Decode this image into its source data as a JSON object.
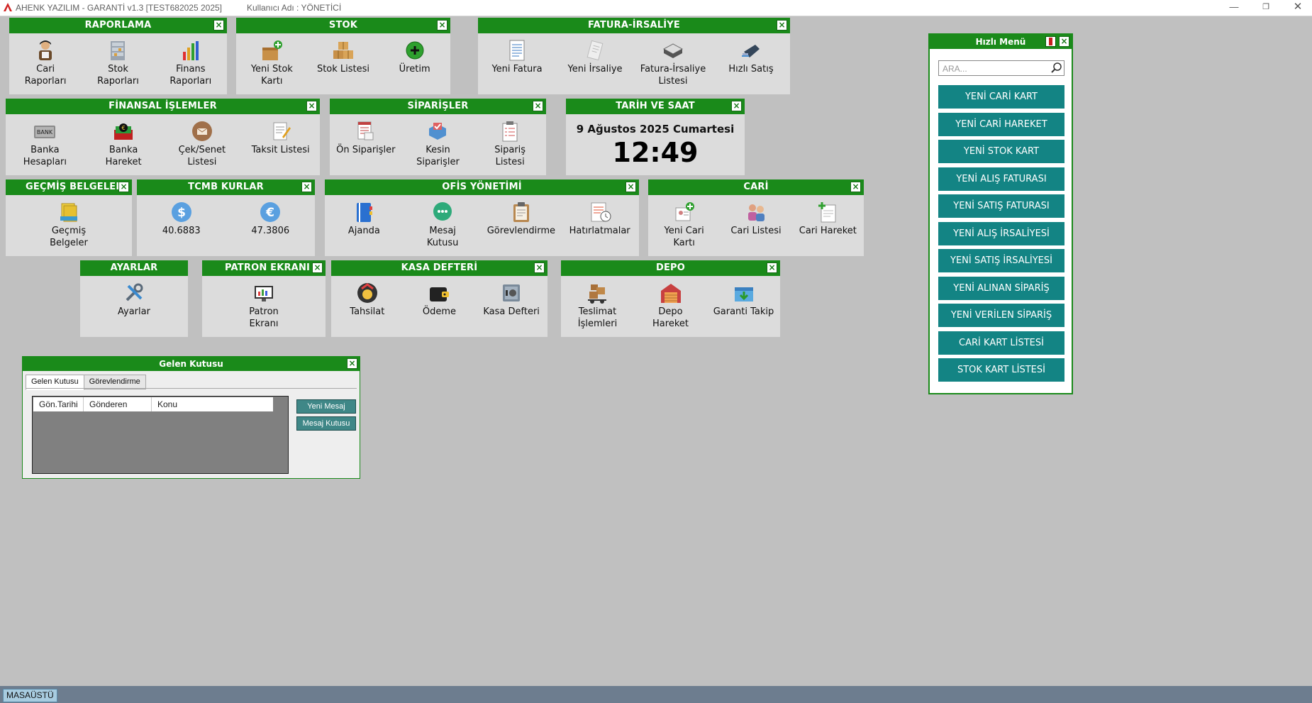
{
  "window": {
    "title": "AHENK YAZILIM - GARANTİ v1.3 [TEST682025 2025]",
    "user": "Kullanıcı Adı : YÖNETİCİ",
    "min_glyph": "—",
    "max_glyph": "❐",
    "close_glyph": "✕"
  },
  "close_glyph": "×",
  "panels": {
    "raporlama": {
      "title": "RAPORLAMA",
      "items": [
        "Cari\nRaporları",
        "Stok\nRaporları",
        "Finans\nRaporları"
      ]
    },
    "stok": {
      "title": "STOK",
      "items": [
        "Yeni Stok\nKartı",
        "Stok Listesi",
        "Üretim"
      ]
    },
    "fatura": {
      "title": "FATURA-İRSALİYE",
      "items": [
        "Yeni Fatura",
        "Yeni İrsaliye",
        "Fatura-İrsaliye\nListesi",
        "Hızlı Satış"
      ]
    },
    "finansal": {
      "title": "FİNANSAL İŞLEMLER",
      "items": [
        "Banka\nHesapları",
        "Banka\nHareket",
        "Çek/Senet\nListesi",
        "Taksit Listesi"
      ]
    },
    "siparisler": {
      "title": "SİPARİŞLER",
      "items": [
        "Ön Siparişler",
        "Kesin\nSiparişler",
        "Sipariş\nListesi"
      ]
    },
    "tarih": {
      "title": "TARİH VE SAAT",
      "date": "9 Ağustos 2025 Cumartesi",
      "time": "12:49"
    },
    "gecmis": {
      "title": "GEÇMİŞ BELGELER",
      "items": [
        "Geçmiş\nBelgeler"
      ]
    },
    "tcmb": {
      "title": "TCMB KURLAR",
      "items": [
        "40.6883",
        "47.3806"
      ]
    },
    "ofis": {
      "title": "OFİS YÖNETİMİ",
      "items": [
        "Ajanda",
        "Mesaj\nKutusu",
        "Görevlendirme",
        "Hatırlatmalar"
      ]
    },
    "cari": {
      "title": "CARİ",
      "items": [
        "Yeni Cari\nKartı",
        "Cari Listesi",
        "Cari Hareket"
      ]
    },
    "ayarlar": {
      "title": "AYARLAR",
      "items": [
        "Ayarlar"
      ]
    },
    "patron": {
      "title": "PATRON EKRANI",
      "items": [
        "Patron\nEkranı"
      ]
    },
    "kasa": {
      "title": "KASA DEFTERİ",
      "items": [
        "Tahsilat",
        "Ödeme",
        "Kasa Defteri"
      ]
    },
    "depo": {
      "title": "DEPO",
      "items": [
        "Teslimat\nİşlemleri",
        "Depo\nHareket",
        "Garanti Takip"
      ]
    }
  },
  "quick_menu": {
    "title": "Hızlı Menü",
    "search_placeholder": "ARA...",
    "buttons": [
      "YENİ CARİ KART",
      "YENİ CARİ HAREKET",
      "YENİ STOK KART",
      "YENİ ALIŞ FATURASI",
      "YENİ SATIŞ FATURASI",
      "YENİ ALIŞ İRSALİYESİ",
      "YENİ SATIŞ İRSALİYESİ",
      "YENİ ALINAN SİPARİŞ",
      "YENİ VERİLEN SİPARİŞ",
      "CARİ KART LİSTESİ",
      "STOK KART LİSTESİ"
    ]
  },
  "inbox": {
    "title": "Gelen Kutusu",
    "tabs": [
      "Gelen Kutusu",
      "Görevlendirme"
    ],
    "columns": [
      "Gön.Tarihi",
      "Gönderen",
      "Konu"
    ],
    "new_message": "Yeni Mesaj",
    "mailbox": "Mesaj Kutusu"
  },
  "taskbar": {
    "item": "MASAÜSTÜ"
  },
  "colors": {
    "header_green": "#1a8a1a",
    "quick_button": "#138484",
    "desktop": "#c0c0c0",
    "panel": "#dcdcdc"
  }
}
